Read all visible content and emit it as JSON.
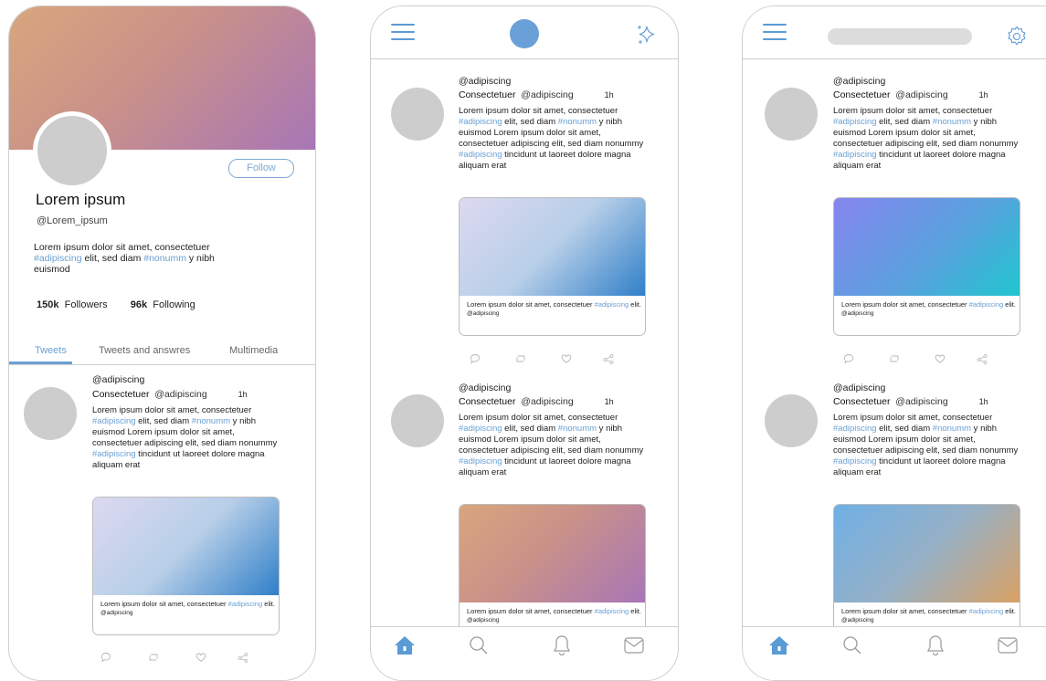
{
  "profile": {
    "follow_label": "Follow",
    "name": "Lorem ipsum",
    "handle": "@Lorem_ipsum",
    "bio_prefix": "Lorem ipsum dolor sit amet, consectetuer",
    "bio_tag1": "#adipiscing",
    "bio_mid": " elit, sed diam ",
    "bio_tag2": "#nonumm",
    "bio_suffix": " y nibh euismod",
    "followers_count": "150k",
    "followers_label": "Followers",
    "following_count": "96k",
    "following_label": "Following",
    "tabs": [
      "Tweets",
      "Tweets and answres",
      "Multimedia"
    ]
  },
  "tweet": {
    "handle_top": "@adipiscing",
    "name": "Consectetuer",
    "handle": "@adipiscing",
    "time": "1h",
    "body_1": "Lorem ipsum dolor sit amet, consectetuer ",
    "tag_1": "#adipiscing",
    "body_2": " elit, sed diam ",
    "tag_2": "#nonumm",
    "body_3": " y nibh euismod Lorem ipsum dolor sit amet, consectetuer adipiscing elit, sed diam nonummy ",
    "tag_3": "#adipiscing",
    "body_4": " tincidunt ut laoreet dolore magna aliquam erat",
    "card_text": "Lorem ipsum dolor sit amet, consectetuer ",
    "card_tag": "#adipiscing",
    "card_text_end": " elit.",
    "card_handle": "@adipiscing"
  },
  "icons": {
    "menu": "hamburger-icon",
    "sparkle": "sparkle-icon",
    "settings": "gear-icon",
    "nav": [
      "home-icon",
      "search-icon",
      "bell-icon",
      "mail-icon"
    ],
    "actions": [
      "reply-icon",
      "retweet-icon",
      "like-icon",
      "share-icon"
    ]
  },
  "colors": {
    "accent": "#6aa0d3",
    "avatar": "#cdcdcd",
    "border": "#cfcfcf"
  }
}
